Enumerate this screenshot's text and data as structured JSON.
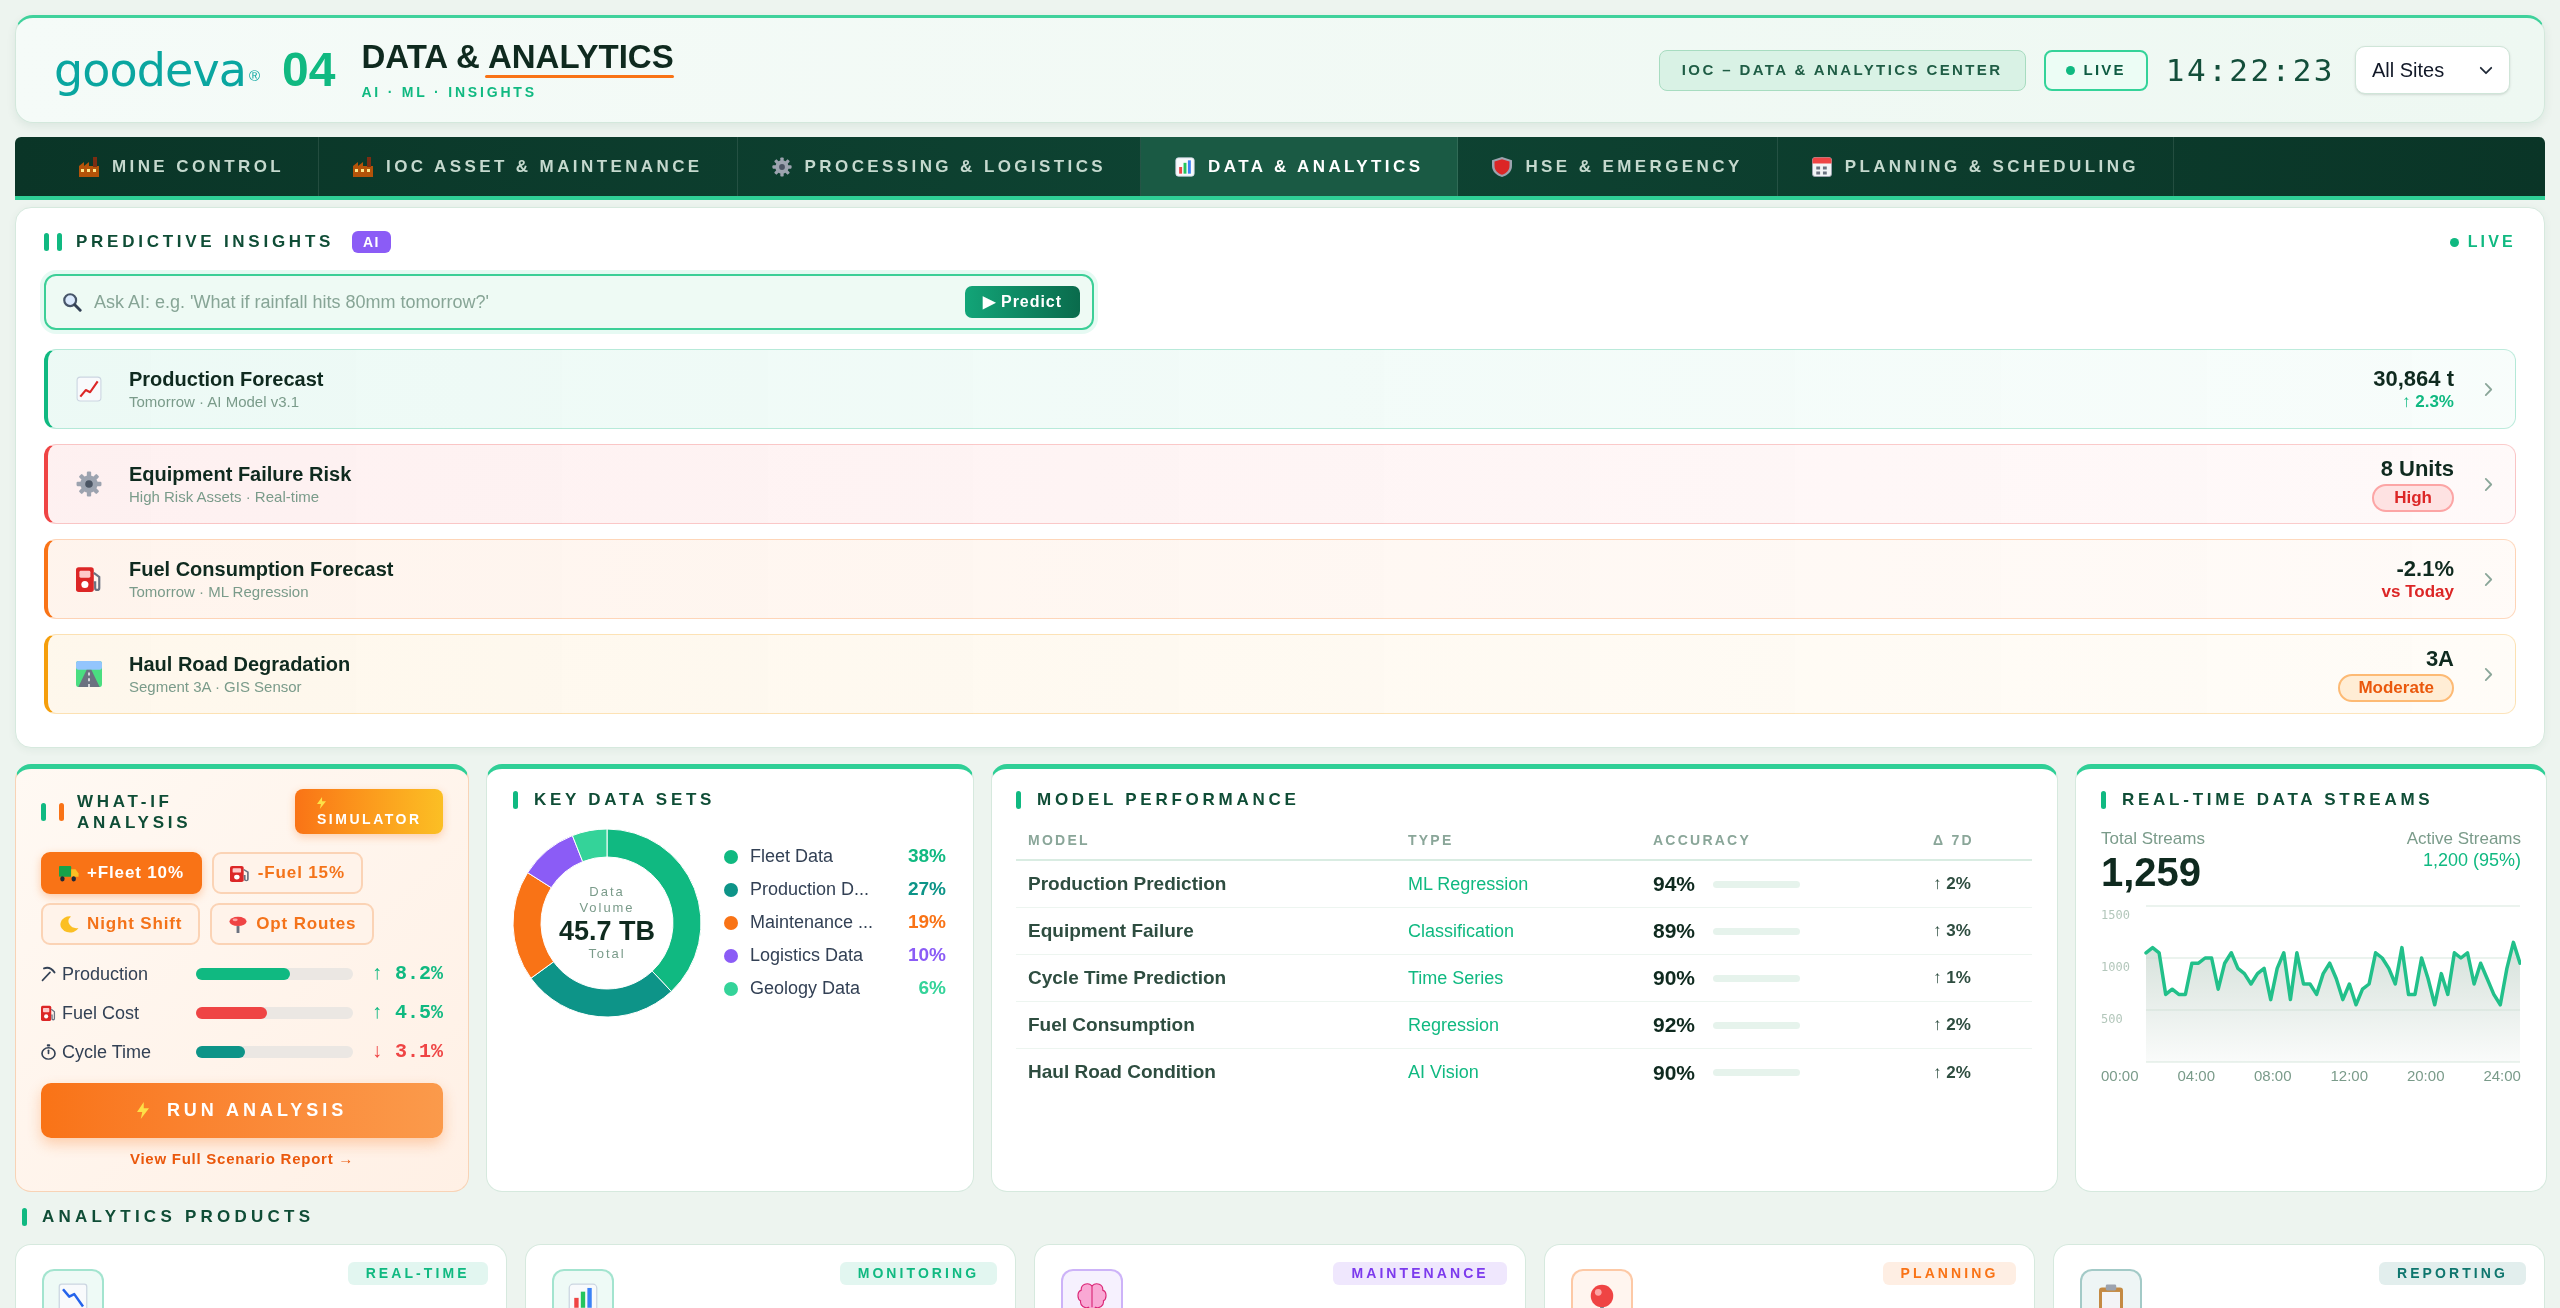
{
  "header": {
    "logo": {
      "wordmark": "goodeva",
      "mark": "®"
    },
    "module_number": "04",
    "title": "DATA & ANALYTICS",
    "subtitle": "AI · ML · INSIGHTS",
    "center_badge": "IOC – DATA & ANALYTICS CENTER",
    "live_badge": "LIVE",
    "clock": "14:22:23",
    "site_select": {
      "value": "All Sites"
    }
  },
  "nav": {
    "tabs": [
      {
        "label": "MINE CONTROL",
        "selected": false
      },
      {
        "label": "IOC ASSET & MAINTENANCE",
        "selected": false
      },
      {
        "label": "PROCESSING & LOGISTICS",
        "selected": false
      },
      {
        "label": "DATA & ANALYTICS",
        "selected": true
      },
      {
        "label": "HSE & EMERGENCY",
        "selected": false
      },
      {
        "label": "PLANNING & SCHEDULING",
        "selected": false
      }
    ]
  },
  "predictive_insights": {
    "title": "PREDICTIVE INSIGHTS",
    "badge": "AI",
    "live": "LIVE",
    "search": {
      "placeholder": "Ask AI: e.g. 'What if rainfall hits 80mm tomorrow?'",
      "button": "▶ Predict"
    },
    "items": [
      {
        "title": "Production Forecast",
        "subtitle": "Tomorrow · AI Model v3.1",
        "value": "30,864 t",
        "note": {
          "kind": "rise",
          "text": "↑ 2.3%"
        },
        "color": "#10b981"
      },
      {
        "title": "Equipment Failure Risk",
        "subtitle": "High Risk Assets · Real-time",
        "value": "8 Units",
        "note": {
          "kind": "alert",
          "text": "High"
        },
        "color": "#ef4444"
      },
      {
        "title": "Fuel Consumption Forecast",
        "subtitle": "Tomorrow · ML Regression",
        "value": "-2.1%",
        "note": {
          "kind": "fall",
          "text": "vs Today"
        },
        "color": "#f97316"
      },
      {
        "title": "Haul Road Degradation",
        "subtitle": "Segment 3A · GIS Sensor",
        "value": "3A",
        "note": {
          "kind": "warning",
          "text": "Moderate"
        },
        "color": "#f59e0b"
      }
    ]
  },
  "what_if": {
    "title": "WHAT-IF ANALYSIS",
    "simulator_button": "SIMULATOR",
    "scenarios": [
      {
        "label": "+Fleet 10%",
        "selected": true
      },
      {
        "label": "-Fuel 15%",
        "selected": false
      },
      {
        "label": "Night Shift",
        "selected": false
      },
      {
        "label": "Opt Routes",
        "selected": false
      }
    ],
    "metrics": [
      {
        "kind": "rise",
        "label": "Production",
        "level": 0.6,
        "change": "↑ 8.2%",
        "color": "#10b981"
      },
      {
        "kind": "rise",
        "label": "Fuel Cost",
        "level": 0.45,
        "change": "↑ 4.5%",
        "color": "#ef4444"
      },
      {
        "kind": "fall",
        "label": "Cycle Time",
        "level": 0.31,
        "change": "↓ 3.1%",
        "color": "#0d9488"
      }
    ],
    "run_button": "RUN ANALYSIS",
    "report_link": "View Full Scenario Report →"
  },
  "key_data_sets": {
    "title": "KEY DATA SETS",
    "center": {
      "label": "Data Volume",
      "value": "45.7 TB",
      "caption": "Total"
    },
    "chart_data": {
      "type": "donut",
      "categories": [
        "Fleet Data",
        "Production D...",
        "Maintenance ...",
        "Logistics Data",
        "Geology Data"
      ],
      "values": [
        38,
        27,
        19,
        10,
        6
      ]
    },
    "legend": [
      {
        "share": "38%",
        "color": "#10b981"
      },
      {
        "share": "27%",
        "color": "#0d9488"
      },
      {
        "share": "19%",
        "color": "#f97316"
      },
      {
        "share": "10%",
        "color": "#8b5cf6"
      },
      {
        "share": "6%",
        "color": "#34d399"
      }
    ]
  },
  "model_performance": {
    "title": "MODEL PERFORMANCE",
    "columns": [
      "MODEL",
      "TYPE",
      "ACCURACY",
      "Δ 7D"
    ],
    "rows": [
      [
        "Production Prediction",
        "ML Regression",
        "94%",
        "↑ 2%"
      ],
      [
        "Equipment Failure",
        "Classification",
        "89%",
        "↑ 3%"
      ],
      [
        "Cycle Time Prediction",
        "Time Series",
        "90%",
        "↑ 1%"
      ],
      [
        "Fuel Consumption",
        "Regression",
        "92%",
        "↑ 2%"
      ],
      [
        "Haul Road Condition",
        "AI Vision",
        "90%",
        "↑ 2%"
      ]
    ]
  },
  "realtime_streams": {
    "title": "REAL-TIME DATA STREAMS",
    "total": {
      "label": "Total Streams",
      "value": "1,259"
    },
    "active": {
      "label": "Active Streams",
      "value": "1,200 (95%)"
    },
    "chart_data": {
      "type": "area",
      "values": [
        1050,
        1100,
        1050,
        650,
        700,
        650,
        650,
        950,
        950,
        1000,
        1000,
        700,
        950,
        1050,
        900,
        850,
        750,
        850,
        900,
        600,
        900,
        1050,
        600,
        1050,
        750,
        750,
        650,
        850,
        950,
        800,
        600,
        750,
        550,
        700,
        750,
        1050,
        1000,
        900,
        750,
        1100,
        650,
        650,
        1000,
        800,
        550,
        850,
        650,
        1050,
        1000,
        1050,
        750,
        950,
        800,
        650,
        550,
        900,
        1150,
        950
      ],
      "ylim": [
        0,
        1500
      ],
      "yticks": [
        500,
        1000,
        1500
      ]
    },
    "x_labels": [
      "00:00",
      "04:00",
      "08:00",
      "12:00",
      "20:00",
      "24:00"
    ]
  },
  "analytics_products": {
    "title": "ANALYTICS PRODUCTS",
    "items": [
      {
        "tag": "REAL-TIME",
        "color": "#10b981"
      },
      {
        "tag": "MONITORING",
        "color": "#10b981"
      },
      {
        "tag": "MAINTENANCE",
        "color": "#7c3aed"
      },
      {
        "tag": "PLANNING",
        "color": "#f97316"
      },
      {
        "tag": "REPORTING",
        "color": "#0f766e"
      }
    ]
  }
}
